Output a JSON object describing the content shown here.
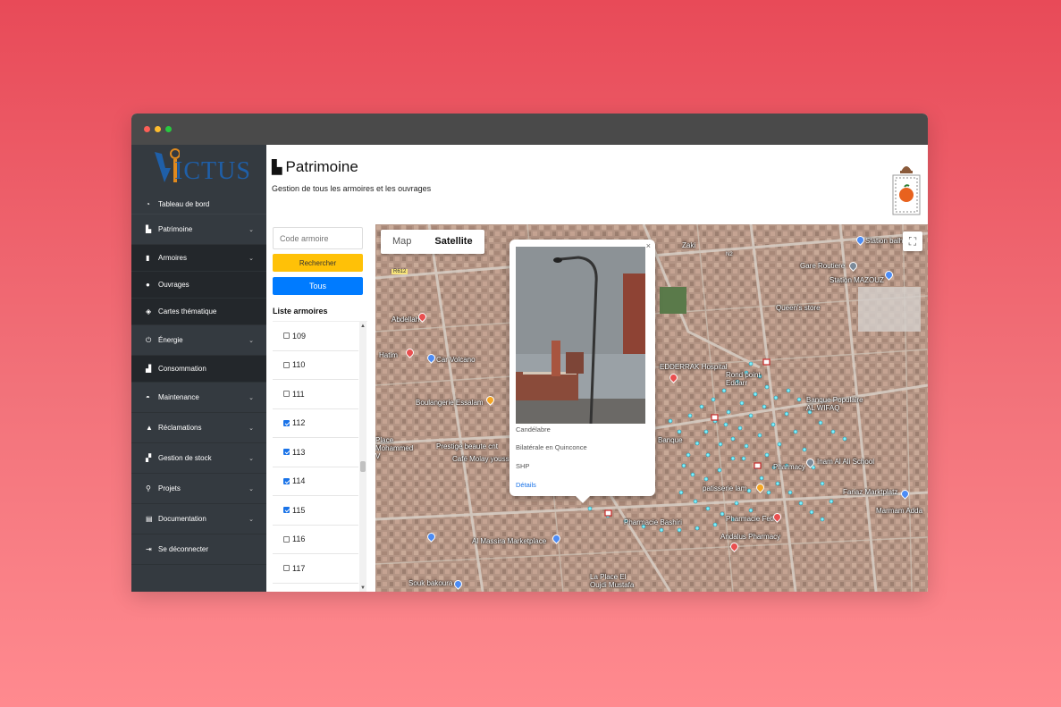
{
  "app": {
    "logo_text": "ICTUS"
  },
  "sidebar": {
    "items": [
      {
        "label": "Tableau de bord",
        "icon": "dashboard-icon"
      },
      {
        "label": "Patrimoine",
        "icon": "map-icon"
      },
      {
        "label": "Armoires",
        "icon": "cabinet-icon"
      },
      {
        "label": "Ouvrages",
        "icon": "bulb-icon"
      },
      {
        "label": "Cartes thématique",
        "icon": "layers-icon"
      },
      {
        "label": "Énergie",
        "icon": "plug-icon"
      },
      {
        "label": "Consommation",
        "icon": "chart-icon"
      },
      {
        "label": "Maintenance",
        "icon": "helmet-icon"
      },
      {
        "label": "Réclamations",
        "icon": "warning-icon"
      },
      {
        "label": "Gestion de stock",
        "icon": "boxes-icon"
      },
      {
        "label": "Projets",
        "icon": "project-icon"
      },
      {
        "label": "Documentation",
        "icon": "document-icon"
      },
      {
        "label": "Se déconnecter",
        "icon": "logout-icon"
      }
    ]
  },
  "header": {
    "title": "Patrimoine",
    "subtitle": "Gestion de tous les armoires et les ouvrages"
  },
  "panel": {
    "search_placeholder": "Code armoire",
    "search_button": "Rechercher",
    "all_button": "Tous",
    "list_title": "Liste armoires",
    "items": [
      {
        "label": "109",
        "checked": false
      },
      {
        "label": "110",
        "checked": false
      },
      {
        "label": "111",
        "checked": false
      },
      {
        "label": "112",
        "checked": true
      },
      {
        "label": "113",
        "checked": true
      },
      {
        "label": "114",
        "checked": true
      },
      {
        "label": "115",
        "checked": true
      },
      {
        "label": "116",
        "checked": false
      },
      {
        "label": "117",
        "checked": false
      }
    ]
  },
  "map": {
    "type_map": "Map",
    "type_satellite": "Satellite",
    "labels": {
      "l1": "Zaki",
      "l2": "Station balh",
      "l3": "Gare Routiere",
      "l4": "Station MAZOUZ",
      "l5": "Queen's store",
      "l6": "Abdellah",
      "l7": "Car Volcano",
      "l8": "EDDERRAK Hospital",
      "l9": "Rond point Eddarr",
      "l10": "Boulangerie Essalam",
      "l11": "Banque Populaire AL WIFAQ",
      "l12": "Prestige beaute cnt",
      "l13": "Café Molay youss",
      "l14": "Inam Al Ali School",
      "l15": "Pharmacy",
      "l16": "patisserie lam",
      "l17": "Fariaz Marktplatz",
      "l18": "Marmam Adda",
      "l19": "Pharmacie Fethi",
      "l20": "Pharmacie Bashiri",
      "l21": "Al Massira Marketplace",
      "l22": "Andalus Pharmacy",
      "l23": "Souk bakoura",
      "l24": "La Place El Oujdi Mustafa",
      "l25": "Place Mohammed V",
      "l26": "Banque",
      "l27": "Hatim",
      "l28": "R612",
      "l29": "N2"
    }
  },
  "popup": {
    "close": "×",
    "line1": "Candélabre",
    "line2": "Bilatérale en Quinconce",
    "line3": "SHP",
    "link": "Détails"
  },
  "colors": {
    "sidebar_bg": "#343a40",
    "accent_yellow": "#ffc107",
    "accent_blue": "#007bff",
    "marker_cyan": "#5fe3f0"
  }
}
